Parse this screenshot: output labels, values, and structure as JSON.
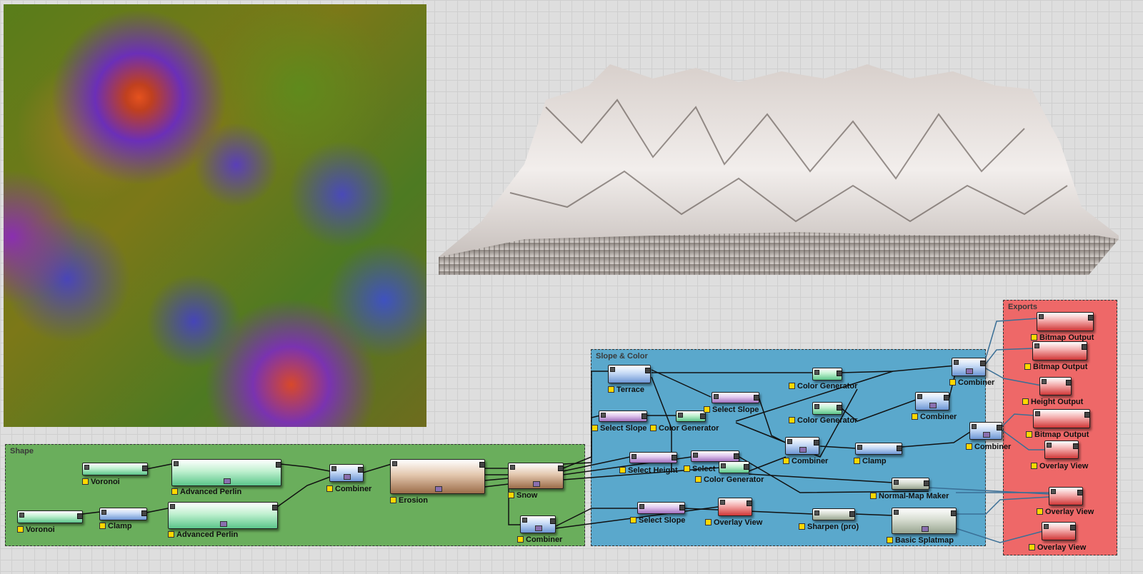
{
  "groups": {
    "shape": "Shape",
    "slope_color": "Slope & Color",
    "exports": "Exports"
  },
  "colors": {
    "shape_group": "#6aae5c",
    "slope_group": "#5aa8cc",
    "exports_group": "#ee6868",
    "wire": "#111111",
    "wire_export": "#3a6f96"
  },
  "nodes": {
    "voronoi_1": "Voronoi",
    "voronoi_2": "Voronoi",
    "clamp_1": "Clamp",
    "advanced_perlin_1": "Advanced Perlin",
    "advanced_perlin_2": "Advanced Perlin",
    "combiner_1": "Combiner",
    "erosion": "Erosion",
    "snow": "Snow",
    "combiner_2": "Combiner",
    "terrace": "Terrace",
    "select_slope_1": "Select Slope",
    "color_generator_1": "Color Generator",
    "select_slope_2": "Select Slope",
    "select_height": "Select Height",
    "select_height_2": "Select",
    "color_generator_2": "Color Generator",
    "color_generator_3": "Color Generator",
    "color_generator_4": "Color Generator",
    "select_slope_3": "Select Slope",
    "overlay_view_1": "Overlay View",
    "combiner_3": "Combiner",
    "clamp_2": "Clamp",
    "combiner_4": "Combiner",
    "combiner_5": "Combiner",
    "combiner_6": "Combiner",
    "normal_map_maker": "Normal-Map Maker",
    "sharpen_pro": "Sharpen (pro)",
    "basic_splatmap": "Basic Splatmap",
    "bitmap_output_1": "Bitmap Output",
    "bitmap_output_2": "Bitmap Output",
    "height_output": "Height Output",
    "bitmap_output_3": "Bitmap Output",
    "overlay_view_2": "Overlay View",
    "overlay_view_3": "Overlay View",
    "overlay_view_4": "Overlay View"
  }
}
